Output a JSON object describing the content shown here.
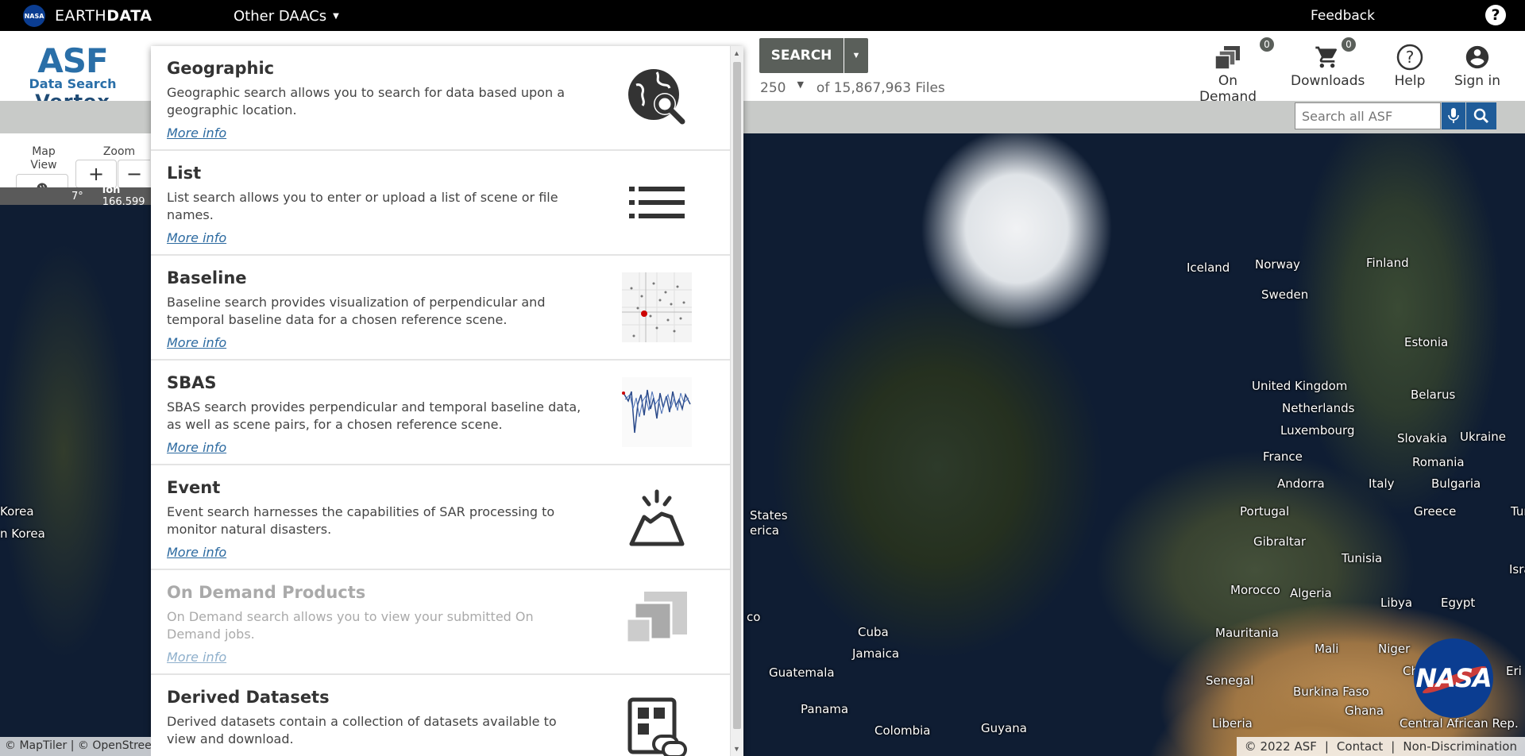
{
  "topbar": {
    "nasa_logo": "NASA",
    "brand_light": "EARTH",
    "brand_bold": "DATA",
    "other_daacs": "Other DAACs",
    "feedback": "Feedback",
    "help": "?"
  },
  "header": {
    "logo": {
      "asf": "ASF",
      "data_search": "Data Search",
      "vertex": "Vertex"
    },
    "search_label": "SEARCH",
    "result_limit": "250",
    "result_total": "of 15,867,963 Files",
    "on_demand": {
      "label": "On Demand",
      "count": "0"
    },
    "downloads": {
      "label": "Downloads",
      "count": "0"
    },
    "help": "Help",
    "sign_in": "Sign in"
  },
  "toolbar": {
    "search_placeholder": "Search all ASF"
  },
  "map_controls": {
    "map_view_label": "Map\nView",
    "map_view_line1": "Map",
    "map_view_line2": "View",
    "zoom_label": "Zoom",
    "zoom_in": "+",
    "zoom_out": "−",
    "lat_fragment": "7°",
    "lon_label": "lon",
    "lon_value": "166.599"
  },
  "dropdown": {
    "items": [
      {
        "title": "Geographic",
        "desc": "Geographic search allows you to search for data based upon a geographic location.",
        "more": "More info",
        "icon": "globe-search-icon"
      },
      {
        "title": "List",
        "desc": "List search allows you to enter or upload a list of scene or file names.",
        "more": "More info",
        "icon": "list-icon"
      },
      {
        "title": "Baseline",
        "desc": "Baseline search provides visualization of perpendicular and temporal baseline data for a chosen reference scene.",
        "more": "More info",
        "icon": "baseline-plot-icon"
      },
      {
        "title": "SBAS",
        "desc": "SBAS search provides perpendicular and temporal baseline data, as well as scene pairs, for a chosen reference scene.",
        "more": "More info",
        "icon": "sbas-plot-icon"
      },
      {
        "title": "Event",
        "desc": "Event search harnesses the capabilities of SAR processing to monitor natural disasters.",
        "more": "More info",
        "icon": "volcano-icon"
      },
      {
        "title": "On Demand Products",
        "desc": "On Demand search allows you to view your submitted On Demand jobs.",
        "more": "More info",
        "icon": "on-demand-icon"
      },
      {
        "title": "Derived Datasets",
        "desc": "Derived datasets contain a collection of datasets available to view and download.",
        "more": "",
        "icon": "derived-dataset-icon"
      }
    ]
  },
  "map_labels": [
    {
      "text": "Iceland"
    },
    {
      "text": "Norway"
    },
    {
      "text": "Finland"
    },
    {
      "text": "Sweden"
    },
    {
      "text": "Estonia"
    },
    {
      "text": "Belarus"
    },
    {
      "text": "United Kingdom"
    },
    {
      "text": "Netherlands"
    },
    {
      "text": "Luxembourg"
    },
    {
      "text": "Slovakia"
    },
    {
      "text": "Ukraine"
    },
    {
      "text": "France"
    },
    {
      "text": "Romania"
    },
    {
      "text": "Andorra"
    },
    {
      "text": "Italy"
    },
    {
      "text": "Bulgaria"
    },
    {
      "text": "Portugal"
    },
    {
      "text": "Greece"
    },
    {
      "text": "Turke"
    },
    {
      "text": "Gibraltar"
    },
    {
      "text": "Tunisia"
    },
    {
      "text": "Israe"
    },
    {
      "text": "Morocco"
    },
    {
      "text": "Algeria"
    },
    {
      "text": "Libya"
    },
    {
      "text": "Egypt"
    },
    {
      "text": "Mauritania"
    },
    {
      "text": "Mali"
    },
    {
      "text": "Niger"
    },
    {
      "text": "Ch"
    },
    {
      "text": "Eri"
    },
    {
      "text": "Senegal"
    },
    {
      "text": "Burkina Faso"
    },
    {
      "text": "Ghana"
    },
    {
      "text": "Liberia"
    },
    {
      "text": "Central African Rep."
    },
    {
      "text": "States"
    },
    {
      "text": "erica"
    },
    {
      "text": "Cuba"
    },
    {
      "text": "Jamaica"
    },
    {
      "text": "Guatemala"
    },
    {
      "text": "Panama"
    },
    {
      "text": "Colombia"
    },
    {
      "text": "Guyana"
    },
    {
      "text": "co"
    },
    {
      "text": "Korea"
    },
    {
      "text": "n Korea"
    }
  ],
  "footer": {
    "attribution": "© MapTiler | © OpenStreetMap",
    "copyright": "© 2022 ASF",
    "contact": "Contact",
    "non_discrimination": "Non-Discrimination"
  }
}
